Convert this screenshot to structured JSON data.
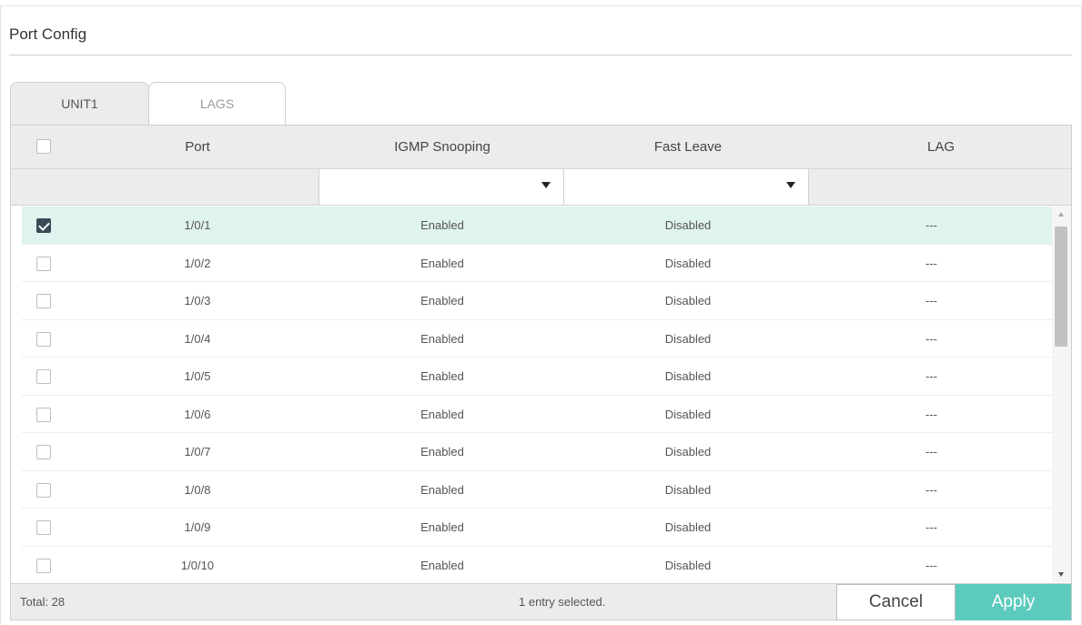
{
  "page": {
    "title": "Port Config"
  },
  "tabs": [
    {
      "label": "UNIT1",
      "active": true
    },
    {
      "label": "LAGS",
      "active": false
    }
  ],
  "table": {
    "columns": [
      "Port",
      "IGMP Snooping",
      "Fast Leave",
      "LAG"
    ],
    "filters": {
      "igmp_snooping": "",
      "fast_leave": ""
    },
    "rows": [
      {
        "port": "1/0/1",
        "igmp": "Enabled",
        "fast_leave": "Disabled",
        "lag": "---",
        "checked": true
      },
      {
        "port": "1/0/2",
        "igmp": "Enabled",
        "fast_leave": "Disabled",
        "lag": "---",
        "checked": false
      },
      {
        "port": "1/0/3",
        "igmp": "Enabled",
        "fast_leave": "Disabled",
        "lag": "---",
        "checked": false
      },
      {
        "port": "1/0/4",
        "igmp": "Enabled",
        "fast_leave": "Disabled",
        "lag": "---",
        "checked": false
      },
      {
        "port": "1/0/5",
        "igmp": "Enabled",
        "fast_leave": "Disabled",
        "lag": "---",
        "checked": false
      },
      {
        "port": "1/0/6",
        "igmp": "Enabled",
        "fast_leave": "Disabled",
        "lag": "---",
        "checked": false
      },
      {
        "port": "1/0/7",
        "igmp": "Enabled",
        "fast_leave": "Disabled",
        "lag": "---",
        "checked": false
      },
      {
        "port": "1/0/8",
        "igmp": "Enabled",
        "fast_leave": "Disabled",
        "lag": "---",
        "checked": false
      },
      {
        "port": "1/0/9",
        "igmp": "Enabled",
        "fast_leave": "Disabled",
        "lag": "---",
        "checked": false
      },
      {
        "port": "1/0/10",
        "igmp": "Enabled",
        "fast_leave": "Disabled",
        "lag": "---",
        "checked": false
      }
    ]
  },
  "footer": {
    "total": "Total: 28",
    "selection": "1 entry selected.",
    "cancel_label": "Cancel",
    "apply_label": "Apply"
  },
  "colors": {
    "accent": "#5ccbbd",
    "selected_row": "#dff3ef",
    "header_bg": "#ececec"
  }
}
